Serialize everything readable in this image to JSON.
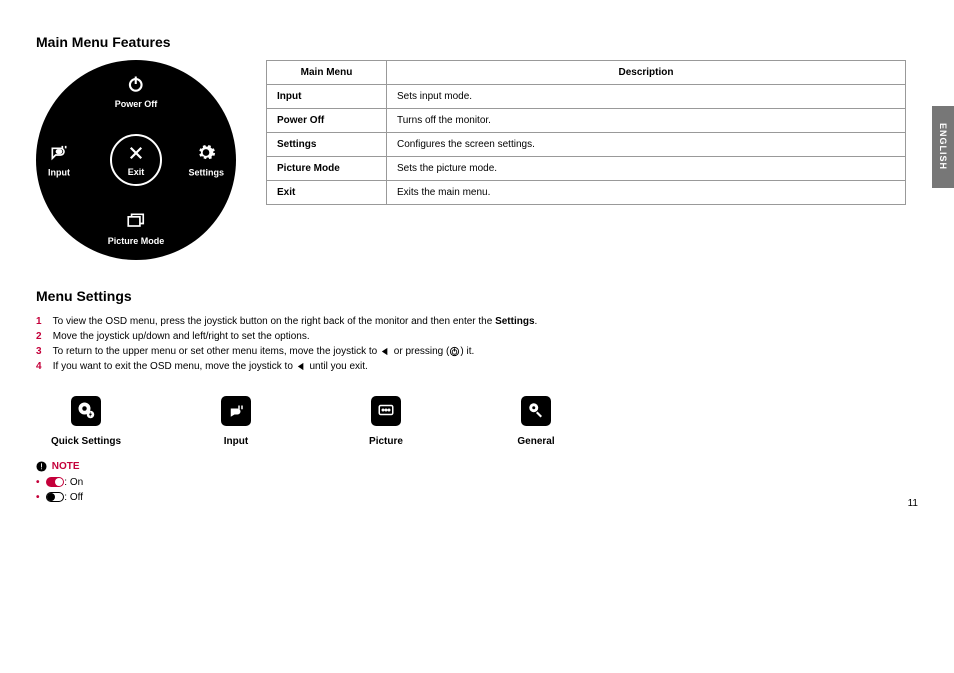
{
  "language_tab": "ENGLISH",
  "page_number": "11",
  "section1": {
    "heading": "Main Menu Features",
    "dial": {
      "top": {
        "label": "Power Off"
      },
      "right": {
        "label": "Settings"
      },
      "bottom": {
        "label": "Picture Mode"
      },
      "left": {
        "label": "Input"
      },
      "center": {
        "label": "Exit"
      }
    },
    "table": {
      "head_menu": "Main Menu",
      "head_desc": "Description",
      "rows": [
        {
          "menu": "Input",
          "desc": "Sets input mode."
        },
        {
          "menu": "Power Off",
          "desc": "Turns off the monitor."
        },
        {
          "menu": "Settings",
          "desc": "Configures the screen settings."
        },
        {
          "menu": "Picture Mode",
          "desc": "Sets the picture mode."
        },
        {
          "menu": "Exit",
          "desc": "Exits the main menu."
        }
      ]
    }
  },
  "section2": {
    "heading": "Menu Settings",
    "steps": [
      {
        "n": "1",
        "pre": "To view the OSD menu, press the joystick button on the right back of the monitor and then enter the ",
        "bold": "Settings",
        "post": "."
      },
      {
        "n": "2",
        "pre": "Move the joystick up/down and left/right to set the options.",
        "bold": "",
        "post": ""
      },
      {
        "n": "3",
        "pre": "To return to the upper menu or set other menu items, move the joystick to ",
        "bold": "",
        "post": "",
        "icons": "left-power"
      },
      {
        "n": "4",
        "pre": "If you want to exit the OSD menu, move the joystick to ",
        "bold": "",
        "post": "",
        "icons": "left"
      }
    ],
    "step3_mid": " or pressing (",
    "step3_end": ") it.",
    "step4_end": " until you exit.",
    "icons_row": [
      {
        "label": "Quick Settings"
      },
      {
        "label": "Input"
      },
      {
        "label": "Picture"
      },
      {
        "label": "General"
      }
    ],
    "note": {
      "heading": "NOTE",
      "on": ": On",
      "off": ": Off"
    }
  }
}
